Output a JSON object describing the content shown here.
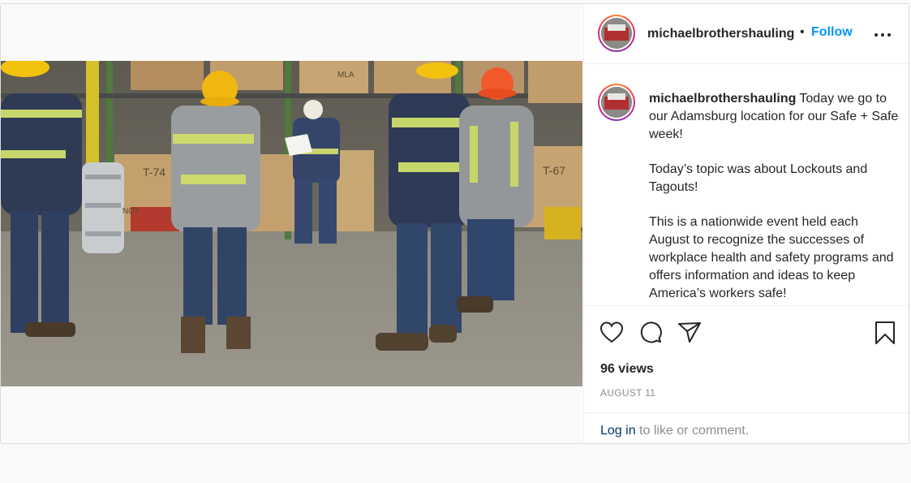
{
  "post": {
    "username": "michaelbrothershauling",
    "follow_label": "Follow",
    "separator": "•",
    "caption_paragraphs": [
      "Today we go to our Adamsburg location for our Safe + Safe week!",
      "Today’s topic was about Lockouts and Tagouts!",
      "This is a nationwide event held each August to recognize the successes of workplace health and safety programs and offers information and ideas to keep America’s workers safe!"
    ],
    "views": "96 views",
    "date": "AUGUST 11",
    "login_link": "Log in",
    "login_rest": " to like or comment."
  },
  "media": {
    "box_labels": [
      "T-74",
      "T-67",
      "NOT",
      "MLA"
    ]
  },
  "icons": {
    "more": "more-options-icon",
    "like": "heart-icon",
    "comment": "comment-icon",
    "share": "paper-plane-icon",
    "save": "bookmark-icon"
  },
  "colors": {
    "follow": "#0095f6",
    "link": "#00376b",
    "muted": "#8e8e8e",
    "text": "#262626"
  }
}
